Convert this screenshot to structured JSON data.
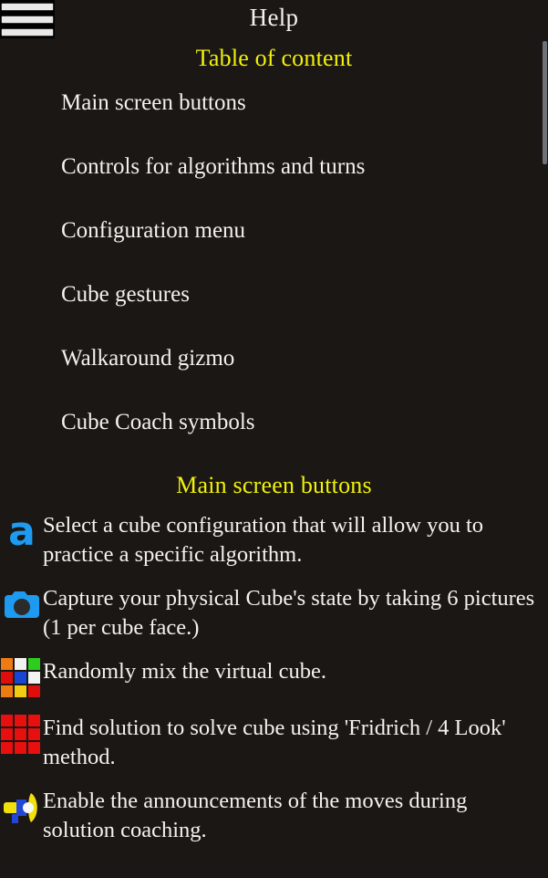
{
  "colors": {
    "background": "#1a1715",
    "heading": "#f2f20a",
    "text": "#f3f1ec",
    "accent_blue": "#1e9bf0",
    "scrollbar": "#6e7178"
  },
  "topbar": {
    "menu_icon": "hamburger-menu-icon",
    "title": "Help"
  },
  "toc": {
    "heading": "Table of content",
    "items": [
      {
        "label": "Main screen buttons"
      },
      {
        "label": "Controls for algorithms and turns"
      },
      {
        "label": "Configuration menu"
      },
      {
        "label": "Cube gestures"
      },
      {
        "label": "Walkaround gizmo"
      },
      {
        "label": "Cube Coach symbols"
      }
    ]
  },
  "main_screen_buttons": {
    "heading": "Main screen buttons",
    "rows": [
      {
        "icon": "letter-a-icon",
        "icon_color": "#1e9bf0",
        "text": "Select a cube configuration that will allow you to practice a specific algorithm."
      },
      {
        "icon": "camera-icon",
        "icon_color": "#1e9bf0",
        "text": "Capture your physical Cube's state by taking 6 pictures (1 per cube face.)"
      },
      {
        "icon": "scrambled-cube-grid-icon",
        "grid_colors": [
          "#ef7c12",
          "#f2f2f2",
          "#2ecc1f",
          "#e00d0d",
          "#1746d4",
          "#f2f2f2",
          "#ef7c12",
          "#f2cc12",
          "#e00d0d"
        ],
        "text": "Randomly mix the virtual cube."
      },
      {
        "icon": "solved-red-cube-grid-icon",
        "grid_colors": [
          "#e80f0f",
          "#e80f0f",
          "#e80f0f",
          "#e80f0f",
          "#e80f0f",
          "#e80f0f",
          "#e80f0f",
          "#e80f0f",
          "#e80f0f"
        ],
        "text": "Find solution to solve cube using 'Fridrich / 4 Look' method."
      },
      {
        "icon": "megaphone-icon",
        "icon_color": "#f2e00a",
        "text": "Enable the announcements of the moves during solution coaching."
      }
    ]
  },
  "scrollbar": {
    "name": "vertical-scrollbar"
  }
}
